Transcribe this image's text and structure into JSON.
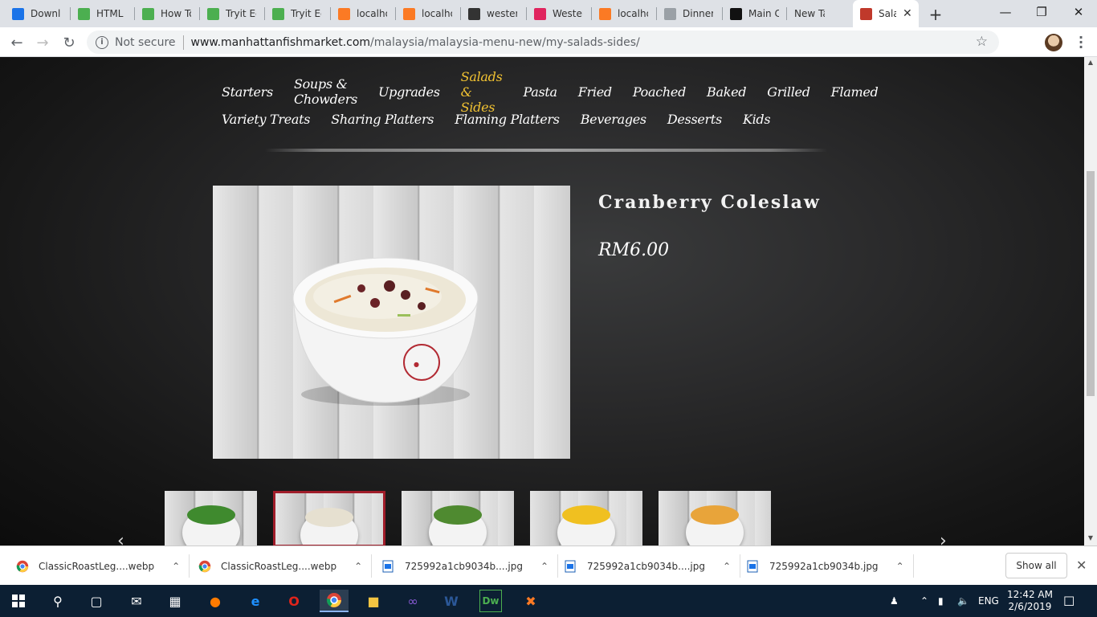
{
  "browser": {
    "tabs": [
      {
        "title": "Downlo",
        "icon": "download-icon",
        "color": "#1a73e8"
      },
      {
        "title": "HTML R",
        "icon": "w3schools-icon",
        "color": "#4caf50"
      },
      {
        "title": "How To",
        "icon": "w3schools-icon",
        "color": "#4caf50"
      },
      {
        "title": "Tryit Ed",
        "icon": "w3schools-icon",
        "color": "#4caf50"
      },
      {
        "title": "Tryit Ed",
        "icon": "w3schools-icon",
        "color": "#4caf50"
      },
      {
        "title": "localho",
        "icon": "xampp-icon",
        "color": "#fb7a24"
      },
      {
        "title": "localho",
        "icon": "xampp-icon",
        "color": "#fb7a24"
      },
      {
        "title": "westerr",
        "icon": "dark-site-icon",
        "color": "#333333"
      },
      {
        "title": "Westerr",
        "icon": "play-icon",
        "color": "#e0245e"
      },
      {
        "title": "localho",
        "icon": "xampp-icon",
        "color": "#fb7a24"
      },
      {
        "title": "Dinner",
        "icon": "page-icon",
        "color": "#9aa0a6"
      },
      {
        "title": "Main Co",
        "icon": "s-logo-icon",
        "color": "#111111"
      },
      {
        "title": "New Tab",
        "icon": "",
        "color": "#ffffff"
      },
      {
        "title": "Sala",
        "icon": "manhattan-logo-icon",
        "color": "#c0392b",
        "active": true
      }
    ],
    "security_label": "Not secure",
    "url_host": "www.manhattanfishmarket.com",
    "url_path": "/malaysia/malaysia-menu-new/my-salads-sides/"
  },
  "menu": {
    "row1": [
      {
        "label": "Starters"
      },
      {
        "label": "Soups & Chowders"
      },
      {
        "label": "Upgrades"
      },
      {
        "label": "Salads & Sides",
        "active": true
      },
      {
        "label": "Pasta"
      },
      {
        "label": "Fried"
      },
      {
        "label": "Poached"
      },
      {
        "label": "Baked"
      },
      {
        "label": "Grilled"
      },
      {
        "label": "Flamed"
      }
    ],
    "row2": [
      {
        "label": "Variety Treats"
      },
      {
        "label": "Sharing Platters"
      },
      {
        "label": "Flaming Platters"
      },
      {
        "label": "Beverages"
      },
      {
        "label": "Desserts"
      },
      {
        "label": "Kids"
      }
    ]
  },
  "product": {
    "name": "Cranberry Coleslaw",
    "price": "RM6.00"
  },
  "thumbnails": [
    {
      "dish": "vegetables",
      "color": "#3f8a2e",
      "selected": false
    },
    {
      "dish": "coleslaw",
      "color": "#e6e0d0",
      "selected": true
    },
    {
      "dish": "salad",
      "color": "#4f8a30",
      "selected": false
    },
    {
      "dish": "corn",
      "color": "#f0c020",
      "selected": false
    },
    {
      "dish": "fries",
      "color": "#e8a43a",
      "selected": false
    }
  ],
  "downloads": {
    "items": [
      {
        "name": "ClassicRoastLeg....webp",
        "icon": "chrome-icon"
      },
      {
        "name": "ClassicRoastLeg....webp",
        "icon": "chrome-icon"
      },
      {
        "name": "725992a1cb9034b....jpg",
        "icon": "image-file-icon"
      },
      {
        "name": "725992a1cb9034b....jpg",
        "icon": "image-file-icon"
      },
      {
        "name": "725992a1cb9034b.jpg",
        "icon": "image-file-icon"
      }
    ],
    "show_all_label": "Show all"
  },
  "taskbar": {
    "language": "ENG",
    "time": "12:42 AM",
    "date": "2/6/2019"
  }
}
